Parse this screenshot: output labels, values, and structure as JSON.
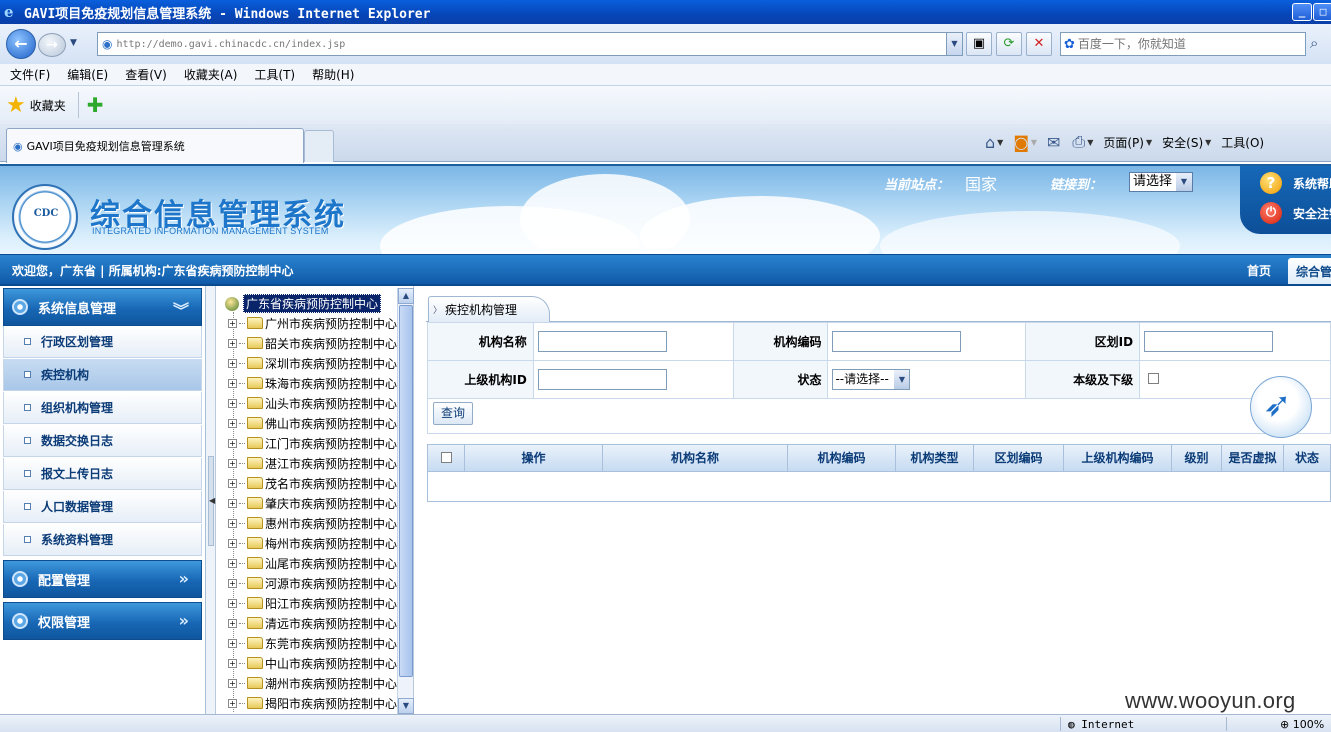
{
  "window": {
    "title": "GAVI项目免疫规划信息管理系统 - Windows Internet Explorer"
  },
  "browser": {
    "url": "http://demo.gavi.chinacdc.cn/index.jsp",
    "search_placeholder": "百度一下，你就知道",
    "menu": [
      "文件(F)",
      "编辑(E)",
      "查看(V)",
      "收藏夹(A)",
      "工具(T)",
      "帮助(H)"
    ],
    "favorites_label": "收藏夹",
    "tab_title": "GAVI项目免疫规划信息管理系统",
    "cmd": {
      "page": "页面(P)",
      "safety": "安全(S)",
      "tools": "工具(O)"
    },
    "status_zone": "Internet",
    "zoom": "100%"
  },
  "header": {
    "title": "综合信息管理系统",
    "subtitle": "INTEGRATED INFORMATION MANAGEMENT SYSTEM",
    "logo_text": "CDC",
    "site_label": "当前站点：",
    "site_value": "国家",
    "link_label": "链接到：",
    "link_select": "请选择",
    "help": "系统帮助",
    "logout": "安全注销",
    "welcome": "欢迎您，广东省 | 所属机构:广东省疾病预防控制中心",
    "home": "首页",
    "current_tab": "综合管理"
  },
  "sidebar": {
    "groups": [
      {
        "label": "系统信息管理",
        "expanded": true
      },
      {
        "label": "配置管理",
        "expanded": false
      },
      {
        "label": "权限管理",
        "expanded": false
      }
    ],
    "items": [
      "行政区划管理",
      "疾控机构",
      "组织机构管理",
      "数据交换日志",
      "报文上传日志",
      "人口数据管理",
      "系统资料管理"
    ],
    "active_item": "疾控机构"
  },
  "tree": {
    "root": "广东省疾病预防控制中心",
    "nodes": [
      "广州市疾病预防控制中心",
      "韶关市疾病预防控制中心",
      "深圳市疾病预防控制中心",
      "珠海市疾病预防控制中心",
      "汕头市疾病预防控制中心",
      "佛山市疾病预防控制中心",
      "江门市疾病预防控制中心",
      "湛江市疾病预防控制中心",
      "茂名市疾病预防控制中心",
      "肇庆市疾病预防控制中心",
      "惠州市疾病预防控制中心",
      "梅州市疾病预防控制中心",
      "汕尾市疾病预防控制中心",
      "河源市疾病预防控制中心",
      "阳江市疾病预防控制中心",
      "清远市疾病预防控制中心",
      "东莞市疾病预防控制中心",
      "中山市疾病预防控制中心",
      "潮州市疾病预防控制中心",
      "揭阳市疾病预防控制中心"
    ]
  },
  "content": {
    "tab": "疾控机构管理",
    "form": {
      "org_name": "机构名称",
      "org_code": "机构编码",
      "region_id": "区划ID",
      "parent_id": "上级机构ID",
      "status": "状态",
      "status_value": "--请选择--",
      "include_sub": "本级及下级"
    },
    "query_button": "查询",
    "columns": [
      "操作",
      "机构名称",
      "机构编码",
      "机构类型",
      "区划编码",
      "上级机构编码",
      "级别",
      "是否虚拟",
      "状态"
    ]
  },
  "watermark": "www.wooyun.org"
}
